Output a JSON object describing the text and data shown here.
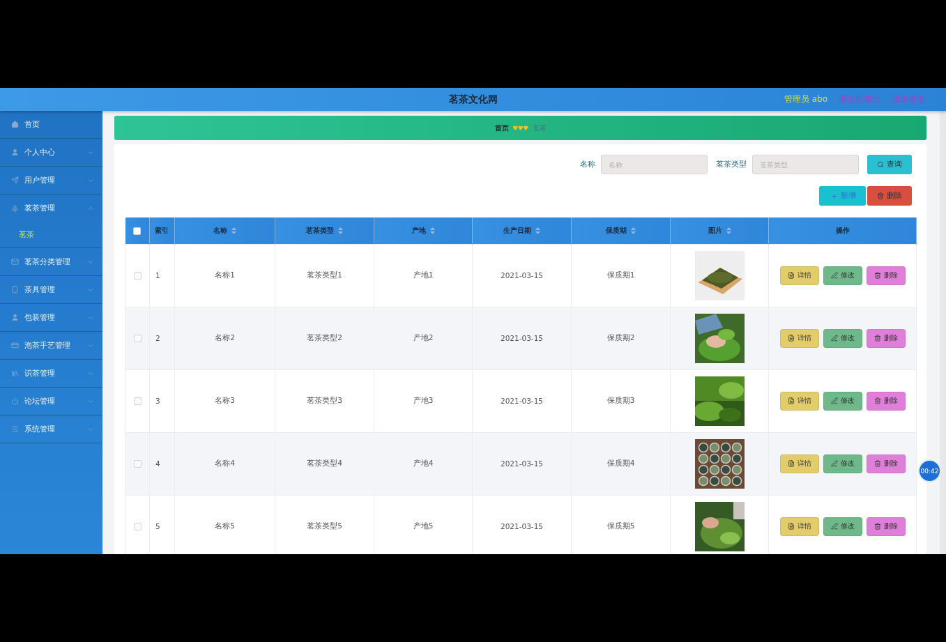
{
  "header": {
    "title": "茗茶文化网",
    "user": "管理员 abo",
    "links": [
      "退出到前台",
      "退出登录"
    ]
  },
  "sidebar": {
    "items": [
      {
        "label": "首页"
      },
      {
        "label": "个人中心",
        "expanded": false
      },
      {
        "label": "用户管理",
        "expanded": false
      },
      {
        "label": "茗茶管理",
        "expanded": true,
        "children": [
          {
            "label": "茗茶",
            "selected": true
          }
        ]
      },
      {
        "label": "茗茶分类管理",
        "expanded": false
      },
      {
        "label": "茶具管理",
        "expanded": false
      },
      {
        "label": "包装管理",
        "expanded": false
      },
      {
        "label": "泡茶手艺管理",
        "expanded": false
      },
      {
        "label": "识茶管理",
        "expanded": false
      },
      {
        "label": "论坛管理",
        "expanded": false
      },
      {
        "label": "系统管理",
        "expanded": false
      }
    ]
  },
  "breadcrumb": [
    "首页",
    "茗茶"
  ],
  "search": {
    "fields": [
      {
        "label": "名称",
        "placeholder": "名称"
      },
      {
        "label": "茗茶类型",
        "placeholder": "茗茶类型"
      }
    ],
    "button": "查询"
  },
  "actions": {
    "add": "新增",
    "delete": "删除"
  },
  "table": {
    "select_all": {
      "checked": false
    },
    "columns": [
      {
        "label": "索引",
        "sortable": false
      },
      {
        "label": "名称",
        "sortable": true
      },
      {
        "label": "茗茶类型",
        "sortable": true
      },
      {
        "label": "产地",
        "sortable": true
      },
      {
        "label": "生产日期",
        "sortable": true
      },
      {
        "label": "保质期",
        "sortable": true
      },
      {
        "label": "图片",
        "sortable": true
      },
      {
        "label": "操作",
        "sortable": false
      }
    ],
    "rows": [
      {
        "checked": false,
        "cells": [
          "1",
          "名称1",
          "茗茶类型1",
          "产地1",
          "2021-03-15",
          "保质期1"
        ],
        "buttons": [
          "详情",
          "修改",
          "删除"
        ]
      },
      {
        "checked": false,
        "cells": [
          "2",
          "名称2",
          "茗茶类型2",
          "产地2",
          "2021-03-15",
          "保质期2"
        ],
        "buttons": [
          "详情",
          "修改",
          "删除"
        ]
      },
      {
        "checked": false,
        "cells": [
          "3",
          "名称3",
          "茗茶类型3",
          "产地3",
          "2021-03-15",
          "保质期3"
        ],
        "buttons": [
          "详情",
          "修改",
          "删除"
        ]
      },
      {
        "checked": false,
        "cells": [
          "4",
          "名称4",
          "茗茶类型4",
          "产地4",
          "2021-03-15",
          "保质期4"
        ],
        "buttons": [
          "详情",
          "修改",
          "删除"
        ]
      },
      {
        "checked": false,
        "cells": [
          "5",
          "名称5",
          "茗茶类型5",
          "产地5",
          "2021-03-15",
          "保质期5"
        ],
        "buttons": [
          "详情",
          "修改",
          "删除"
        ]
      }
    ]
  },
  "timer": "00:42"
}
